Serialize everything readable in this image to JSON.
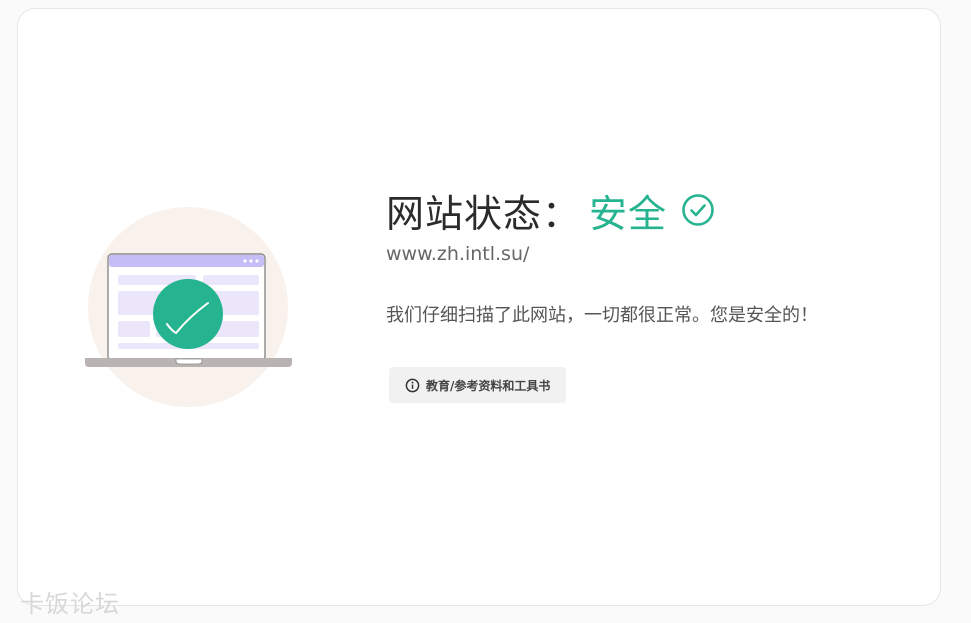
{
  "status": {
    "label": "网站状态：",
    "value": "安全",
    "icon": "check-circle-icon"
  },
  "site": {
    "url": "www.zh.intl.su/"
  },
  "description": "我们仔细扫描了此网站，一切都很正常。您是安全的！",
  "category": {
    "icon": "info-icon",
    "label": "教育/参考资料和工具书"
  },
  "watermark": "卡饭论坛",
  "colors": {
    "safe_green": "#26b38f",
    "laptop_header": "#c5bdf5",
    "laptop_blocks": "#ece6fb",
    "background_circle": "#f8f1ec"
  }
}
